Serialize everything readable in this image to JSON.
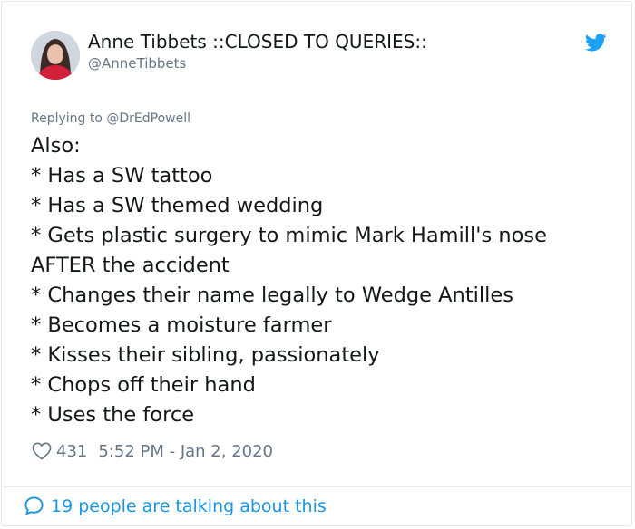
{
  "author": {
    "display_name": "Anne Tibbets ::CLOSED TO QUERIES::",
    "handle": "@AnneTibbets"
  },
  "replying_to": {
    "prefix": "Replying to",
    "mention": "@DrEdPowell"
  },
  "tweet": {
    "lines": [
      "Also:",
      "* Has a SW tattoo",
      "* Has a SW themed wedding",
      "* Gets plastic surgery to mimic Mark Hamill's nose",
      "AFTER the accident",
      "* Changes their name legally to Wedge Antilles",
      "* Becomes a moisture farmer",
      "* Kisses their sibling, passionately",
      "* Chops off their hand",
      "* Uses the force"
    ]
  },
  "meta": {
    "likes": "431",
    "timestamp": "5:52 PM - Jan 2, 2020"
  },
  "footer": {
    "talking_text": "19 people are talking about this"
  },
  "icons": {
    "brand": "twitter-bird-icon",
    "like": "heart-icon",
    "reply": "speech-bubble-icon"
  },
  "colors": {
    "brand": "#1da1f2",
    "link": "#1b95e0",
    "muted": "#657786",
    "text": "#14171a"
  }
}
